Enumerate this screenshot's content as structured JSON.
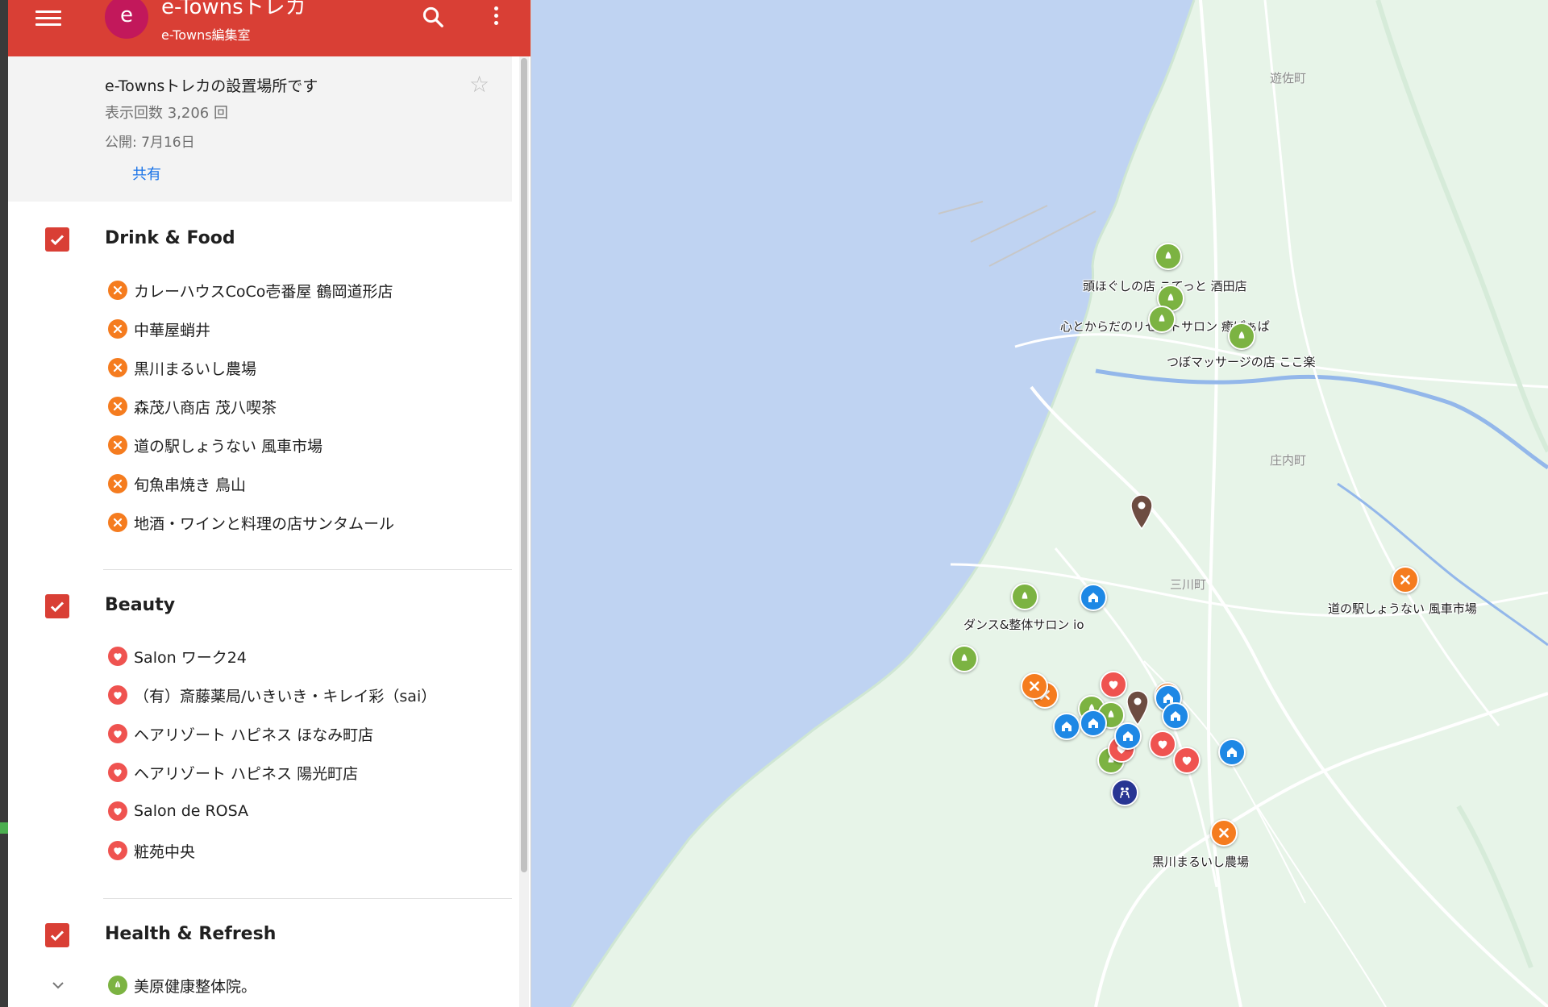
{
  "header": {
    "avatar_letter": "e",
    "title": "e-Townsトレカ",
    "subtitle": "e-Towns編集室",
    "menu_icon": "hamburger-menu-icon",
    "search_icon": "search-icon",
    "more_icon": "more-vert-icon"
  },
  "info": {
    "description": "e-Townsトレカの設置場所です",
    "views": "表示回数 3,206 回",
    "published": "公開: 7月16日",
    "share_label": "共有",
    "star_icon": "star-outline-icon"
  },
  "layers": [
    {
      "title": "Drink & Food",
      "checked": true,
      "icon": "fork-knife-icon",
      "color": "#f57c1f",
      "items": [
        "カレーハウスCoCo壱番屋 鶴岡道形店",
        "中華屋蛸井",
        "黒川まるいし農場",
        "森茂八商店 茂八喫茶",
        "道の駅しょうない 風車市場",
        "旬魚串焼き 鳥山",
        "地酒・ワインと料理の店サンタムール"
      ]
    },
    {
      "title": "Beauty",
      "checked": true,
      "icon": "heart-icon",
      "color": "#ef5350",
      "items": [
        "Salon ワーク24",
        "（有）斎藤薬局/いきいき・キレイ彩（sai）",
        "ヘアリゾート ハピネス ほなみ町店",
        "ヘアリゾート ハピネス 陽光町店",
        "Salon de ROSA",
        "粧苑中央"
      ]
    },
    {
      "title": "Health & Refresh",
      "checked": true,
      "icon": "leaf-icon",
      "color": "#7cb342",
      "items": [
        "美原健康整体院。"
      ]
    }
  ],
  "map": {
    "sea_color": "#bfd3f2",
    "land_color": "#e7f4e8",
    "town_labels": [
      "遊佐町",
      "庄内町",
      "三川町"
    ],
    "place_labels": [
      "頭ほぐしの店 こてっと 酒田店",
      "心とからだのリセットサロン 癒ぱぁぱ",
      "つぼマッサージの店 ここ楽",
      "ダンス&整体サロン io",
      "道の駅しょうない 風車市場",
      "黒川まるいし農場"
    ]
  }
}
